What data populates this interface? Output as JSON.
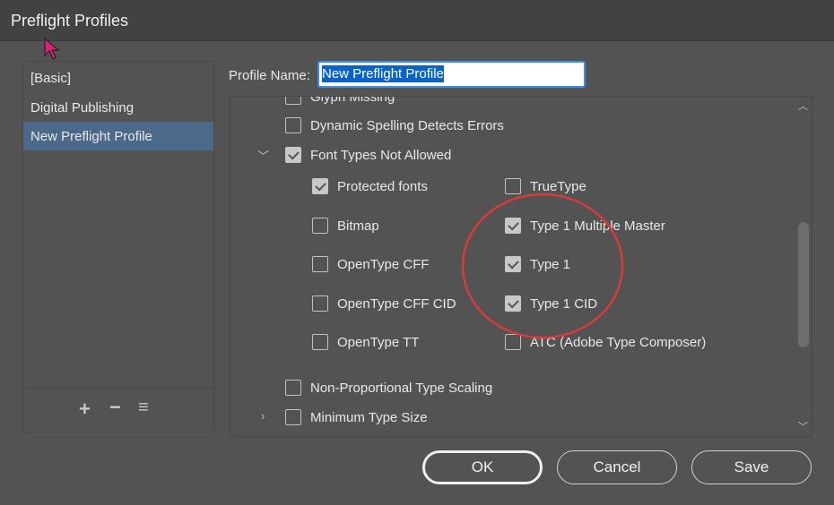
{
  "window": {
    "title": "Preflight Profiles"
  },
  "profiles": {
    "items": [
      {
        "label": "[Basic]"
      },
      {
        "label": "Digital Publishing"
      },
      {
        "label": "New Preflight Profile",
        "selected": true
      }
    ],
    "footer_icons": [
      "plus-icon",
      "minus-icon",
      "menu-icon"
    ]
  },
  "profile_name": {
    "label": "Profile Name:",
    "value": "New Preflight Profile"
  },
  "rules": {
    "glyph_missing": {
      "label": "Glyph Missing",
      "checked": false
    },
    "spelling": {
      "label": "Dynamic Spelling Detects Errors",
      "checked": false
    },
    "font_types": {
      "label": "Font Types Not Allowed",
      "checked": true,
      "expanded": true,
      "options": [
        {
          "label": "Protected fonts",
          "checked": true
        },
        {
          "label": "TrueType",
          "checked": false
        },
        {
          "label": "Bitmap",
          "checked": false
        },
        {
          "label": "Type 1 Multiple Master",
          "checked": true
        },
        {
          "label": "OpenType CFF",
          "checked": false
        },
        {
          "label": "Type 1",
          "checked": true
        },
        {
          "label": "OpenType CFF CID",
          "checked": false
        },
        {
          "label": "Type 1 CID",
          "checked": true
        },
        {
          "label": "OpenType TT",
          "checked": false
        },
        {
          "label": "ATC (Adobe Type Composer)",
          "checked": false
        }
      ]
    },
    "non_prop": {
      "label": "Non-Proportional Type Scaling",
      "checked": false
    },
    "min_size": {
      "label": "Minimum Type Size",
      "checked": false,
      "expanded": false
    }
  },
  "buttons": {
    "ok": "OK",
    "cancel": "Cancel",
    "save": "Save"
  },
  "colors": {
    "selection": "#4b6a8a",
    "annotation": "#d93a3a",
    "cursor": "#e0207a"
  }
}
